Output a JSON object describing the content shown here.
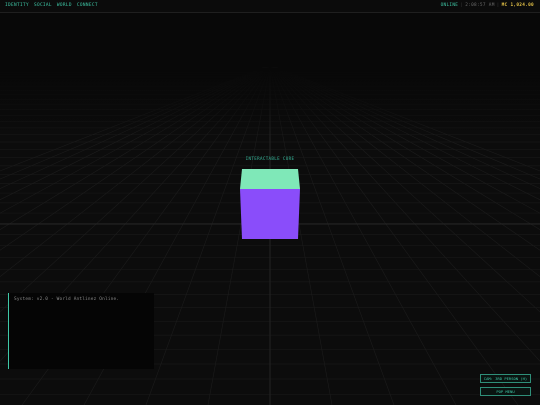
{
  "topbar": {
    "nav": [
      "IDENTITY",
      "SOCIAL",
      "WORLD",
      "CONNECT"
    ],
    "status": {
      "online": "ONLINE",
      "separator": "|",
      "time": "2:08:57 AM",
      "currency": "MC 1,024.00"
    }
  },
  "scene": {
    "cube_label": "INTERACTABLE CORE",
    "cube_colors": {
      "top": "#7fe8b8",
      "front": "#8a4dfa"
    },
    "grid_color": "#1c1c1c",
    "axis_color": "#262626"
  },
  "console": {
    "lines": [
      "System: v2.0 - World Antlinez Online."
    ]
  },
  "controls": {
    "camera_label": "CAM: 3RD PERSON (H)",
    "menu_label": "POP MENU"
  },
  "colors": {
    "accent": "#3fc9a8",
    "currency": "#e3c147",
    "background": "#080808"
  }
}
